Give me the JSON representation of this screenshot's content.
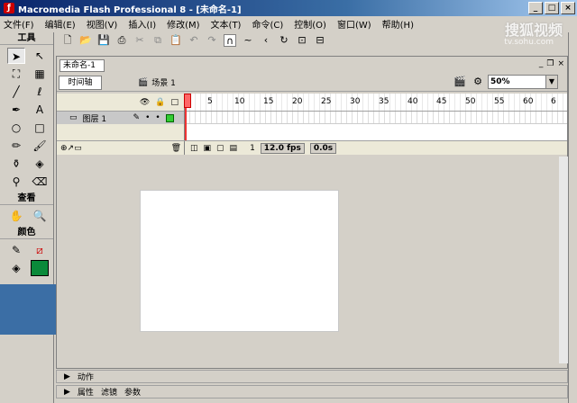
{
  "window": {
    "title": "Macromedia Flash Professional 8 - [未命名-1]",
    "buttons": [
      "_",
      "□",
      "×"
    ]
  },
  "menu": [
    "文件(F)",
    "编辑(E)",
    "视图(V)",
    "插入(I)",
    "修改(M)",
    "文本(T)",
    "命令(C)",
    "控制(O)",
    "窗口(W)",
    "帮助(H)"
  ],
  "watermark": {
    "brand": "搜狐视频",
    "url": "tv.sohu.com"
  },
  "toolbox": {
    "title": "工具",
    "view_title": "查看",
    "color_title": "颜色"
  },
  "tooltip": "撤消",
  "document": {
    "tab": "未命名-1",
    "timeline_button": "时间轴",
    "scene": "场景 1",
    "zoom": "50%"
  },
  "timeline": {
    "layer_name": "图层 1",
    "ruler": [
      "1",
      "5",
      "10",
      "15",
      "20",
      "25",
      "30",
      "35",
      "40",
      "45",
      "50",
      "55",
      "60",
      "6"
    ],
    "current_frame": "1",
    "fps": "12.0 fps",
    "time": "0.0s"
  },
  "panels": {
    "actions": "动作",
    "properties": [
      "属性",
      "滤镜",
      "参数"
    ]
  }
}
